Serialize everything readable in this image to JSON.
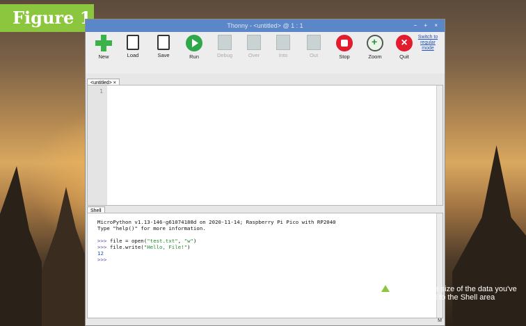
{
  "figure_tag": "Figure 1",
  "window": {
    "title": "Thonny - <untitled> @ 1 : 1",
    "controls": "− + ×"
  },
  "toolbar": {
    "new": "New",
    "load": "Load",
    "save": "Save",
    "run": "Run",
    "debug": "Debug",
    "over": "Over",
    "into": "Into",
    "out": "Out",
    "stop": "Stop",
    "zoom": "Zoom",
    "quit": "Quit",
    "switch_mode": "Switch to regular mode"
  },
  "editor": {
    "tab_label": "<untitled> ×",
    "line_number": "1"
  },
  "shell": {
    "tab_label": "Shell",
    "banner_line1": "MicroPython v1.13-146-g61074188d on 2020-11-14; Raspberry Pi Pico with RP2040",
    "banner_line2": "Type \"help()\" for more information.",
    "prompt": ">>>",
    "cmd1": "file = open(\"test.txt\", \"w\")",
    "cmd2": "file.write(\"Hello, File!\")",
    "output": "12",
    "status": "M"
  },
  "caption": {
    "bold": "Figure 1",
    "text": "The size of the data you've written is printed to the Shell area"
  },
  "colors": {
    "accent_green": "#8cc63f",
    "titlebar_blue": "#5b86c7",
    "run_green": "#2ea84a",
    "stop_red": "#e21b2e"
  }
}
